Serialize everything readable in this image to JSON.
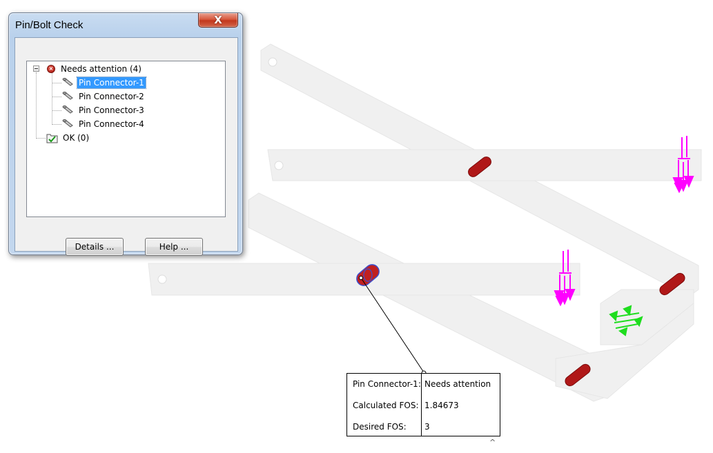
{
  "dialog": {
    "title": "Pin/Bolt Check",
    "close_label": "X",
    "tree": {
      "groups": [
        {
          "label": "Needs attention (4)",
          "status": "error",
          "children": [
            {
              "label": "Pin Connector-1",
              "selected": true
            },
            {
              "label": "Pin Connector-2",
              "selected": false
            },
            {
              "label": "Pin Connector-3",
              "selected": false
            },
            {
              "label": "Pin Connector-4",
              "selected": false
            }
          ]
        },
        {
          "label": "OK (0)",
          "status": "ok",
          "children": []
        }
      ]
    },
    "buttons": {
      "details": "Details ...",
      "help": "Help ..."
    }
  },
  "callout": {
    "rows": [
      {
        "key": "Pin Connector-1:",
        "value": "Needs attention"
      },
      {
        "key": "Calculated FOS:",
        "value": "1.84673"
      },
      {
        "key": "Desired FOS:",
        "value": "3"
      }
    ],
    "collapse_icon": "chevron-up-icon",
    "collapse_glyph": "^"
  },
  "colors": {
    "pin_red": "#b01818",
    "load_arrow_magenta": "#ff00ff",
    "fixture_green": "#1fdd1f",
    "selected_pin_blue": "#3a4fd0",
    "part_body": "#f0f0f0"
  }
}
